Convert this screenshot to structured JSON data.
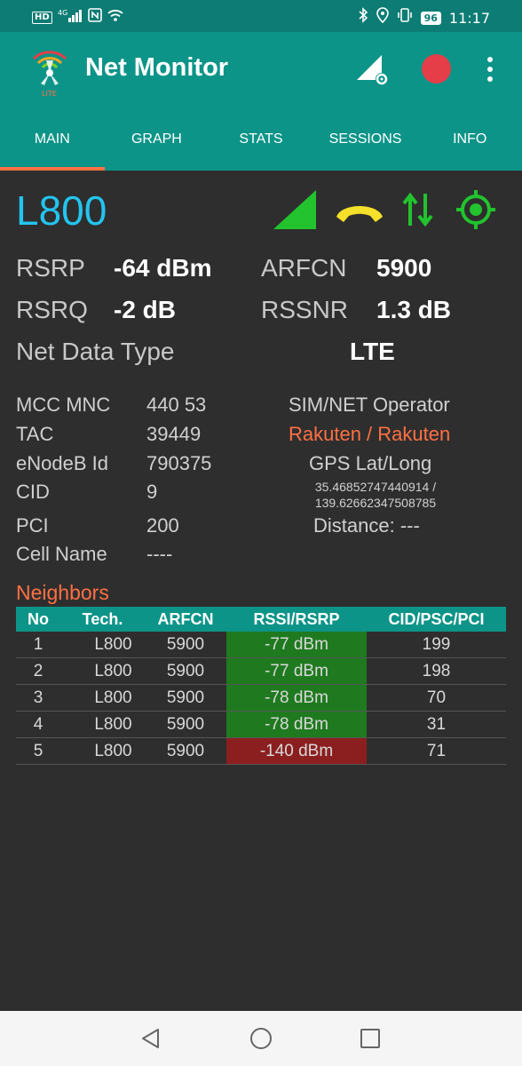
{
  "status_bar": {
    "left_icons": [
      "hd-badge",
      "4g-signal-icon",
      "nfc-icon",
      "wifi-icon"
    ],
    "hd_label": "HD",
    "network_label": "4G",
    "right_icons": [
      "bluetooth-icon",
      "location-icon",
      "vibrate-icon",
      "battery-icon"
    ],
    "battery_level": "96",
    "time": "11:17"
  },
  "app_bar": {
    "title": "Net Monitor",
    "logo_badge": "LITE",
    "actions": [
      "signal-settings-icon",
      "record-icon",
      "more-options-icon"
    ],
    "record_color": "#e53e48"
  },
  "tabs": [
    {
      "label": "MAIN",
      "active": true
    },
    {
      "label": "GRAPH",
      "active": false
    },
    {
      "label": "STATS",
      "active": false
    },
    {
      "label": "SESSIONS",
      "active": false
    },
    {
      "label": "INFO",
      "active": false
    }
  ],
  "main": {
    "band": "L800",
    "indicators": [
      "signal-strength-icon",
      "call-state-icon",
      "data-activity-icon",
      "gps-fix-icon"
    ],
    "metrics": {
      "rsrp_label": "RSRP",
      "rsrp_value": "-64 dBm",
      "arfcn_label": "ARFCN",
      "arfcn_value": "5900",
      "rsrq_label": "RSRQ",
      "rsrq_value": "-2 dB",
      "rssnr_label": "RSSNR",
      "rssnr_value": "1.3 dB",
      "net_data_type_label": "Net Data Type",
      "net_data_type_value": "LTE"
    },
    "cell_info": {
      "mcc_mnc_label": "MCC MNC",
      "mcc_mnc_value": "440 53",
      "tac_label": "TAC",
      "tac_value": "39449",
      "enodeb_label": "eNodeB Id",
      "enodeb_value": "790375",
      "cid_label": "CID",
      "cid_value": "9",
      "pci_label": "PCI",
      "pci_value": "200",
      "cell_name_label": "Cell Name",
      "cell_name_value": "----",
      "operator_label": "SIM/NET Operator",
      "operator_value": "Rakuten / Rakuten",
      "gps_label": "GPS Lat/Long",
      "gps_lat": "35.46852747440914 /",
      "gps_long": "139.62662347508785",
      "distance_label": "Distance: ---"
    },
    "neighbors": {
      "title": "Neighbors",
      "columns": [
        "No",
        "Tech.",
        "ARFCN",
        "RSSI/RSRP",
        "CID/PSC/PCI"
      ],
      "rows": [
        {
          "no": "1",
          "tech": "L800",
          "arfcn": "5900",
          "rsrp": "-77 dBm",
          "cid": "199",
          "quality": "good"
        },
        {
          "no": "2",
          "tech": "L800",
          "arfcn": "5900",
          "rsrp": "-77 dBm",
          "cid": "198",
          "quality": "good"
        },
        {
          "no": "3",
          "tech": "L800",
          "arfcn": "5900",
          "rsrp": "-78 dBm",
          "cid": "70",
          "quality": "good"
        },
        {
          "no": "4",
          "tech": "L800",
          "arfcn": "5900",
          "rsrp": "-78 dBm",
          "cid": "31",
          "quality": "good"
        },
        {
          "no": "5",
          "tech": "L800",
          "arfcn": "5900",
          "rsrp": "-140 dBm",
          "cid": "71",
          "quality": "bad"
        }
      ]
    }
  },
  "nav_bar": [
    "back-icon",
    "home-icon",
    "recent-apps-icon"
  ],
  "colors": {
    "primary": "#0d9488",
    "accent": "#ff7043",
    "band": "#23c4f0",
    "good": "#1f7a1f",
    "bad": "#8b1f1f",
    "signal": "#22c32e",
    "call": "#f5e02a"
  }
}
